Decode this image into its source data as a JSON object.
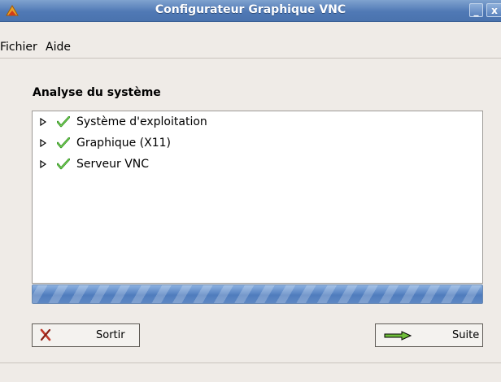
{
  "window": {
    "title": "Configurateur Graphique VNC",
    "minimize_label": "_",
    "close_label": "x"
  },
  "menubar": {
    "items": [
      "Fichier",
      "Aide"
    ]
  },
  "analysis": {
    "title": "Analyse du système",
    "items": [
      {
        "label": "Système d'exploitation",
        "status": "ok"
      },
      {
        "label": "Graphique (X11)",
        "status": "ok"
      },
      {
        "label": "Serveur VNC",
        "status": "ok"
      }
    ],
    "progress_percent": 100
  },
  "buttons": {
    "exit_label": "Sortir",
    "next_label": "Suite"
  },
  "colors": {
    "titlebar": "#5079b5",
    "check": "#2e8b1e",
    "exit_icon": "#c0392b",
    "progress": "#5e88c4"
  },
  "icons": {
    "app": "vnc-app-icon",
    "expander": "triangle-right-icon",
    "status": "checkmark-icon",
    "exit": "red-x-icon",
    "next": "arrow-right-icon"
  }
}
